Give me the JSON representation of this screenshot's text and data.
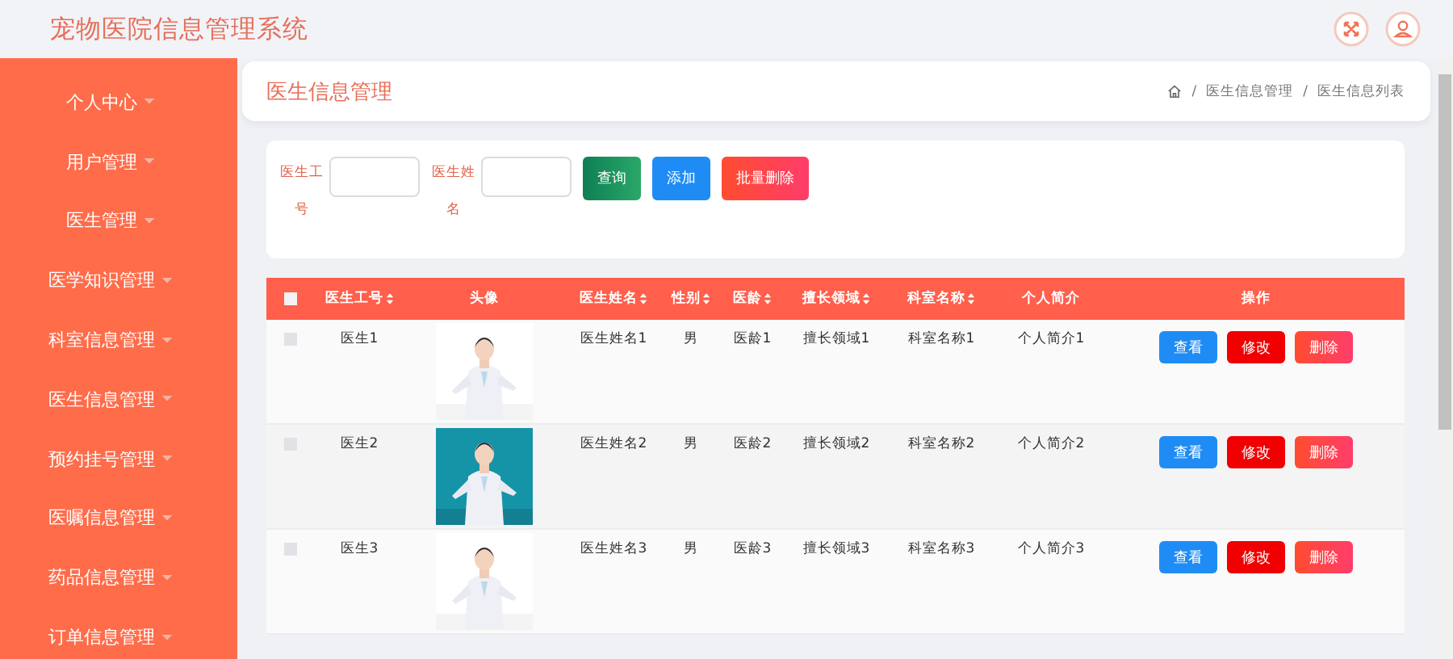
{
  "app_title": "宠物医院信息管理系统",
  "sidebar": {
    "items": [
      {
        "label": "个人中心",
        "selected": false
      },
      {
        "label": "用户管理",
        "selected": false
      },
      {
        "label": "医生管理",
        "selected": false
      },
      {
        "label": "医学知识管理",
        "selected": false
      },
      {
        "label": "科室信息管理",
        "selected": false
      },
      {
        "label": "医生信息管理",
        "selected": false
      },
      {
        "label": "预约挂号管理",
        "selected": false
      },
      {
        "label": "医嘱信息管理",
        "selected": false
      },
      {
        "label": "药品信息管理",
        "selected": false
      },
      {
        "label": "订单信息管理",
        "selected": false
      }
    ]
  },
  "page_title": "医生信息管理",
  "breadcrumb_separator": "/",
  "breadcrumb": [
    "医生信息管理",
    "医生信息列表"
  ],
  "search": {
    "fields": [
      {
        "label": "医生工号"
      },
      {
        "label": "医生姓名"
      }
    ],
    "buttons": [
      {
        "label": "查询",
        "kind": "query"
      },
      {
        "label": "添加",
        "kind": "add"
      },
      {
        "label": "批量删除",
        "kind": "batch-delete"
      }
    ]
  },
  "table": {
    "header_checked": false,
    "columns": [
      {
        "label": "医生工号",
        "sortable": true
      },
      {
        "label": "头像",
        "sortable": false
      },
      {
        "label": "医生姓名",
        "sortable": true
      },
      {
        "label": "性别",
        "sortable": true
      },
      {
        "label": "医龄",
        "sortable": true
      },
      {
        "label": "擅长领域",
        "sortable": true
      },
      {
        "label": "科室名称",
        "sortable": true
      },
      {
        "label": "个人简介",
        "sortable": false
      },
      {
        "label": "操作",
        "sortable": false
      }
    ],
    "rows": [
      {
        "checked": false,
        "id": "医生1",
        "name": "医生姓名1",
        "gender": "男",
        "years": "医龄1",
        "field": "擅长领域1",
        "dept": "科室名称1",
        "intro": "个人简介1",
        "actions": [
          "查看",
          "修改",
          "删除"
        ]
      },
      {
        "checked": false,
        "id": "医生2",
        "name": "医生姓名2",
        "gender": "男",
        "years": "医龄2",
        "field": "擅长领域2",
        "dept": "科室名称2",
        "intro": "个人简介2",
        "actions": [
          "查看",
          "修改",
          "删除"
        ]
      },
      {
        "checked": false,
        "id": "医生3",
        "name": "医生姓名3",
        "gender": "男",
        "years": "医龄3",
        "field": "擅长领域3",
        "dept": "科室名称3",
        "intro": "个人简介3",
        "actions": [
          "查看",
          "修改",
          "删除"
        ]
      }
    ]
  }
}
